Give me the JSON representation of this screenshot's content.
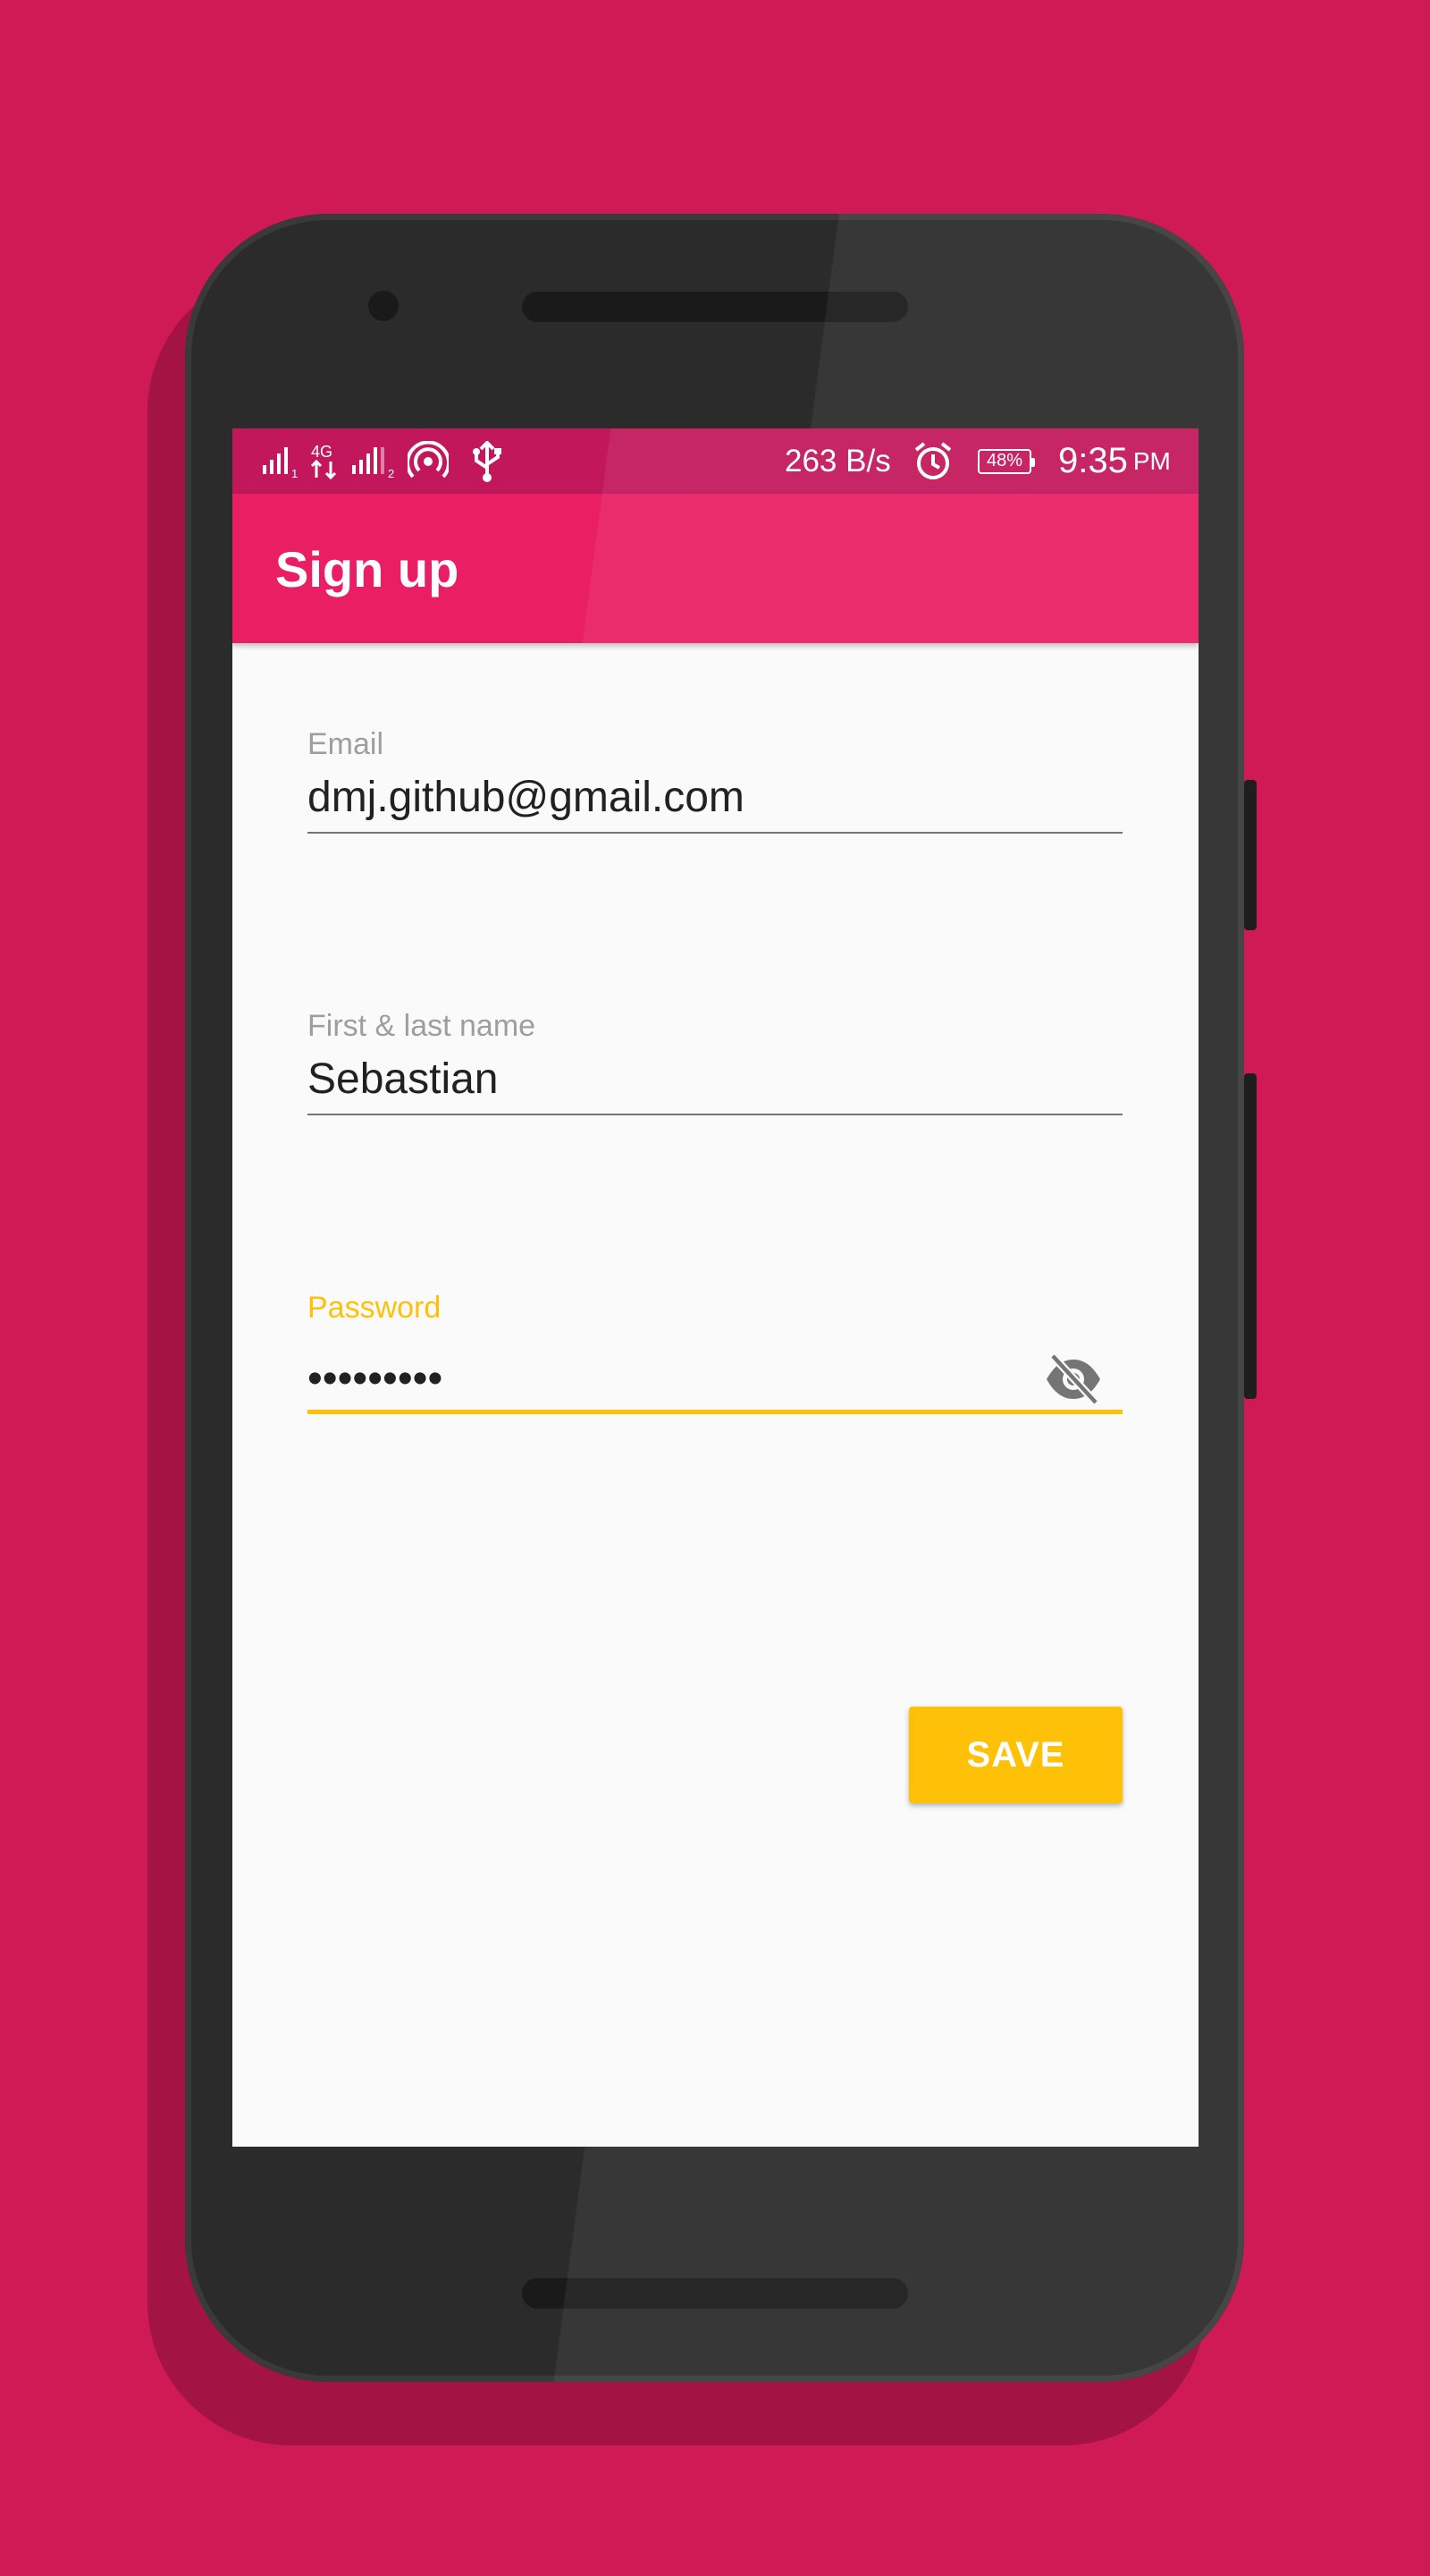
{
  "colors": {
    "background": "#D01A56",
    "status_bar": "#C2185B",
    "app_bar": "#E91E63",
    "accent": "#FFC107",
    "screen": "#FAFAFA"
  },
  "status_bar": {
    "icons": [
      "signal-sim1-icon",
      "4g-data-icon",
      "signal-sim2-icon",
      "hotspot-icon",
      "usb-icon",
      "alarm-icon",
      "battery-icon"
    ],
    "sim1_index": "1",
    "network_type": "4G",
    "sim2_index": "2",
    "network_speed": "263 B/s",
    "battery_percent": "48%",
    "time": "9:35",
    "time_suffix": "PM"
  },
  "app_bar": {
    "title": "Sign up"
  },
  "form": {
    "email": {
      "label": "Email",
      "value": "dmj.github@gmail.com"
    },
    "name": {
      "label": "First & last name",
      "value": "Sebastian"
    },
    "password": {
      "label": "Password",
      "value": "•••••••••",
      "toggle_icon": "visibility-off-icon"
    },
    "save_label": "SAVE"
  }
}
